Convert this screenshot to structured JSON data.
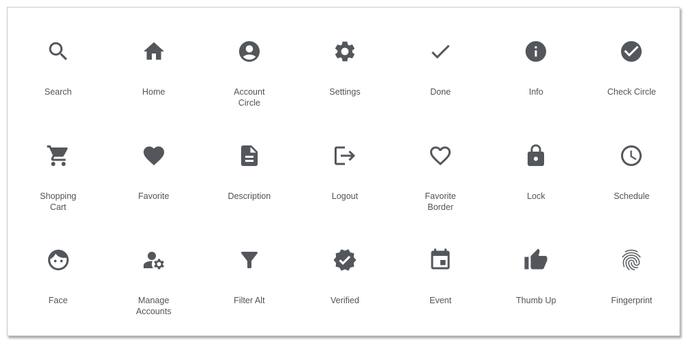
{
  "panel_title": "",
  "colors": {
    "icon": "#53575c",
    "label": "#505358",
    "border": "#c9c9c9",
    "background": "#ffffff"
  },
  "icons": [
    {
      "name": "search",
      "label": "Search"
    },
    {
      "name": "home",
      "label": "Home"
    },
    {
      "name": "account-circle",
      "label": "Account Circle"
    },
    {
      "name": "settings",
      "label": "Settings"
    },
    {
      "name": "done",
      "label": "Done"
    },
    {
      "name": "info",
      "label": "Info"
    },
    {
      "name": "check-circle",
      "label": "Check Circle"
    },
    {
      "name": "shopping-cart",
      "label": "Shopping Cart"
    },
    {
      "name": "favorite",
      "label": "Favorite"
    },
    {
      "name": "description",
      "label": "Description"
    },
    {
      "name": "logout",
      "label": "Logout"
    },
    {
      "name": "favorite-border",
      "label": "Favorite Border"
    },
    {
      "name": "lock",
      "label": "Lock"
    },
    {
      "name": "schedule",
      "label": "Schedule"
    },
    {
      "name": "face",
      "label": "Face"
    },
    {
      "name": "manage-accounts",
      "label": "Manage Accounts"
    },
    {
      "name": "filter-alt",
      "label": "Filter Alt"
    },
    {
      "name": "verified",
      "label": "Verified"
    },
    {
      "name": "event",
      "label": "Event"
    },
    {
      "name": "thumb-up",
      "label": "Thumb Up"
    },
    {
      "name": "fingerprint",
      "label": "Fingerprint"
    }
  ]
}
